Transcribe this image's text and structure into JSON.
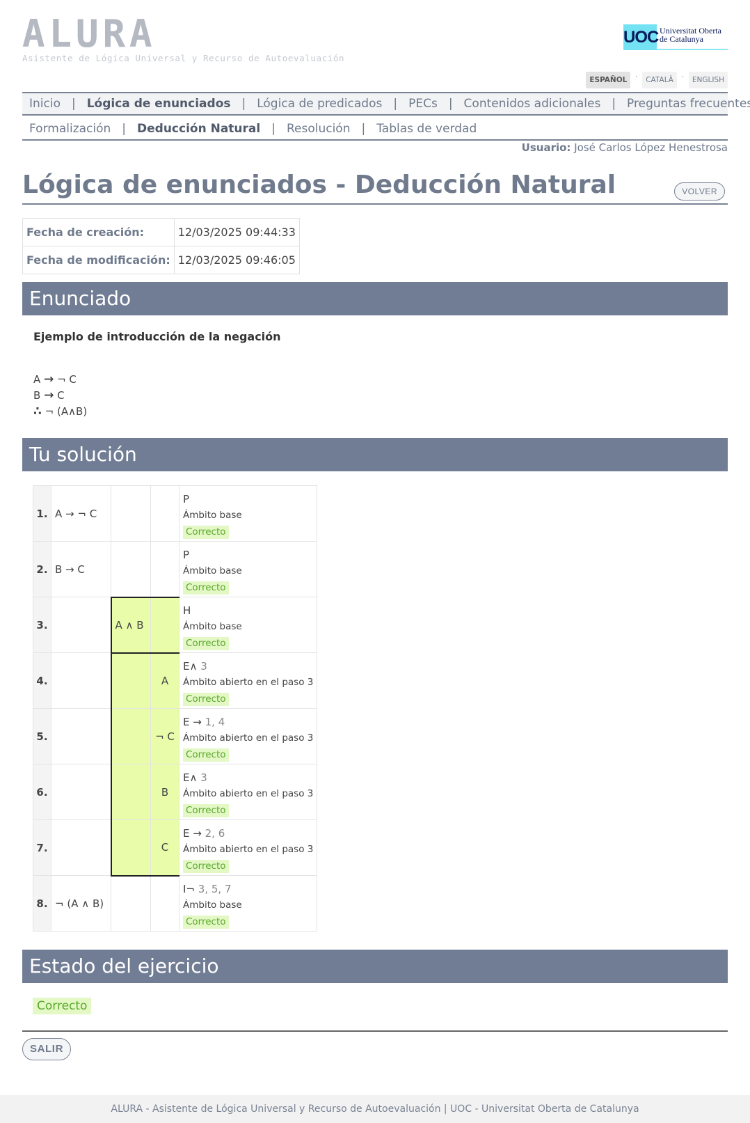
{
  "header": {
    "logo_text": "ALURA",
    "logo_subtitle": "Asistente de Lógica Universal y Recurso de Autoevaluación",
    "partner_logo_mark": "UOC",
    "partner_logo_text_line1": "Universitat Oberta",
    "partner_logo_text_line2": "de Catalunya",
    "languages": [
      "ESPAÑOL",
      "CATALÀ",
      "ENGLISH"
    ],
    "language_separator": "·",
    "active_language": "ESPAÑOL"
  },
  "nav": {
    "main": [
      "Inicio",
      "Lógica de enunciados",
      "Lógica de predicados",
      "PECs",
      "Contenidos adicionales",
      "Preguntas frecuentes"
    ],
    "sub": [
      "Formalización",
      "Deducción Natural",
      "Resolución",
      "Tablas de verdad"
    ],
    "separator": "|"
  },
  "user": {
    "label": "Usuario:",
    "name": "José Carlos López Henestrosa"
  },
  "page": {
    "title": "Lógica de enunciados - Deducción Natural",
    "back_button": "VOLVER"
  },
  "meta": {
    "created_label": "Fecha de creación:",
    "created_value": "12/03/2025 09:44:33",
    "modified_label": "Fecha de modificación:",
    "modified_value": "12/03/2025 09:46:05"
  },
  "sections": {
    "statement": "Enunciado",
    "solution": "Tu solución",
    "status": "Estado del ejercicio"
  },
  "statement": {
    "heading": "Ejemplo de introducción de la negación",
    "formulas": [
      {
        "a": "A",
        "op": "→",
        "b": "¬ C"
      },
      {
        "a": "B",
        "op": "→",
        "b": "C"
      },
      {
        "therefore": "∴",
        "rest": "¬ (A∧B)"
      }
    ]
  },
  "symbols": {
    "implies": "→",
    "and": "∧",
    "not": "¬",
    "therefore": "∴"
  },
  "solution": {
    "steps": [
      {
        "num": "1.",
        "col1": "A → ¬ C",
        "col2": "",
        "col3": "",
        "rule": "P",
        "refs": "",
        "scope": "Ámbito base",
        "status": "Correcto"
      },
      {
        "num": "2.",
        "col1": "B → C",
        "col2": "",
        "col3": "",
        "rule": "P",
        "refs": "",
        "scope": "Ámbito base",
        "status": "Correcto"
      },
      {
        "num": "3.",
        "col1": "",
        "col2": "A ∧ B",
        "col3": "",
        "rule": "H",
        "refs": "",
        "scope": "Ámbito base",
        "status": "Correcto"
      },
      {
        "num": "4.",
        "col1": "",
        "col2": "",
        "col3": "A",
        "rule": "E∧",
        "refs": "3",
        "scope": "Ámbito abierto en el paso 3",
        "status": "Correcto"
      },
      {
        "num": "5.",
        "col1": "",
        "col2": "",
        "col3": "¬ C",
        "rule": "E →",
        "refs": "1, 4",
        "scope": "Ámbito abierto en el paso 3",
        "status": "Correcto"
      },
      {
        "num": "6.",
        "col1": "",
        "col2": "",
        "col3": "B",
        "rule": "E∧",
        "refs": "3",
        "scope": "Ámbito abierto en el paso 3",
        "status": "Correcto"
      },
      {
        "num": "7.",
        "col1": "",
        "col2": "",
        "col3": "C",
        "rule": "E →",
        "refs": "2, 6",
        "scope": "Ámbito abierto en el paso 3",
        "status": "Correcto"
      },
      {
        "num": "8.",
        "col1": "¬ (A ∧ B)",
        "col2": "",
        "col3": "",
        "rule": "I¬",
        "refs": "3, 5, 7",
        "scope": "Ámbito base",
        "status": "Correcto"
      }
    ],
    "hypothesis_scope_color": "#e8fcaa"
  },
  "exercise_status": "Correcto",
  "exit_button": "SALIR",
  "footer": "ALURA - Asistente de Lógica Universal y Recurso de Autoevaluación | UOC - Universitat Oberta de Catalunya",
  "colors": {
    "accent": "#717d94",
    "success_bg": "#e3f8c4",
    "success_text": "#59a82b"
  }
}
